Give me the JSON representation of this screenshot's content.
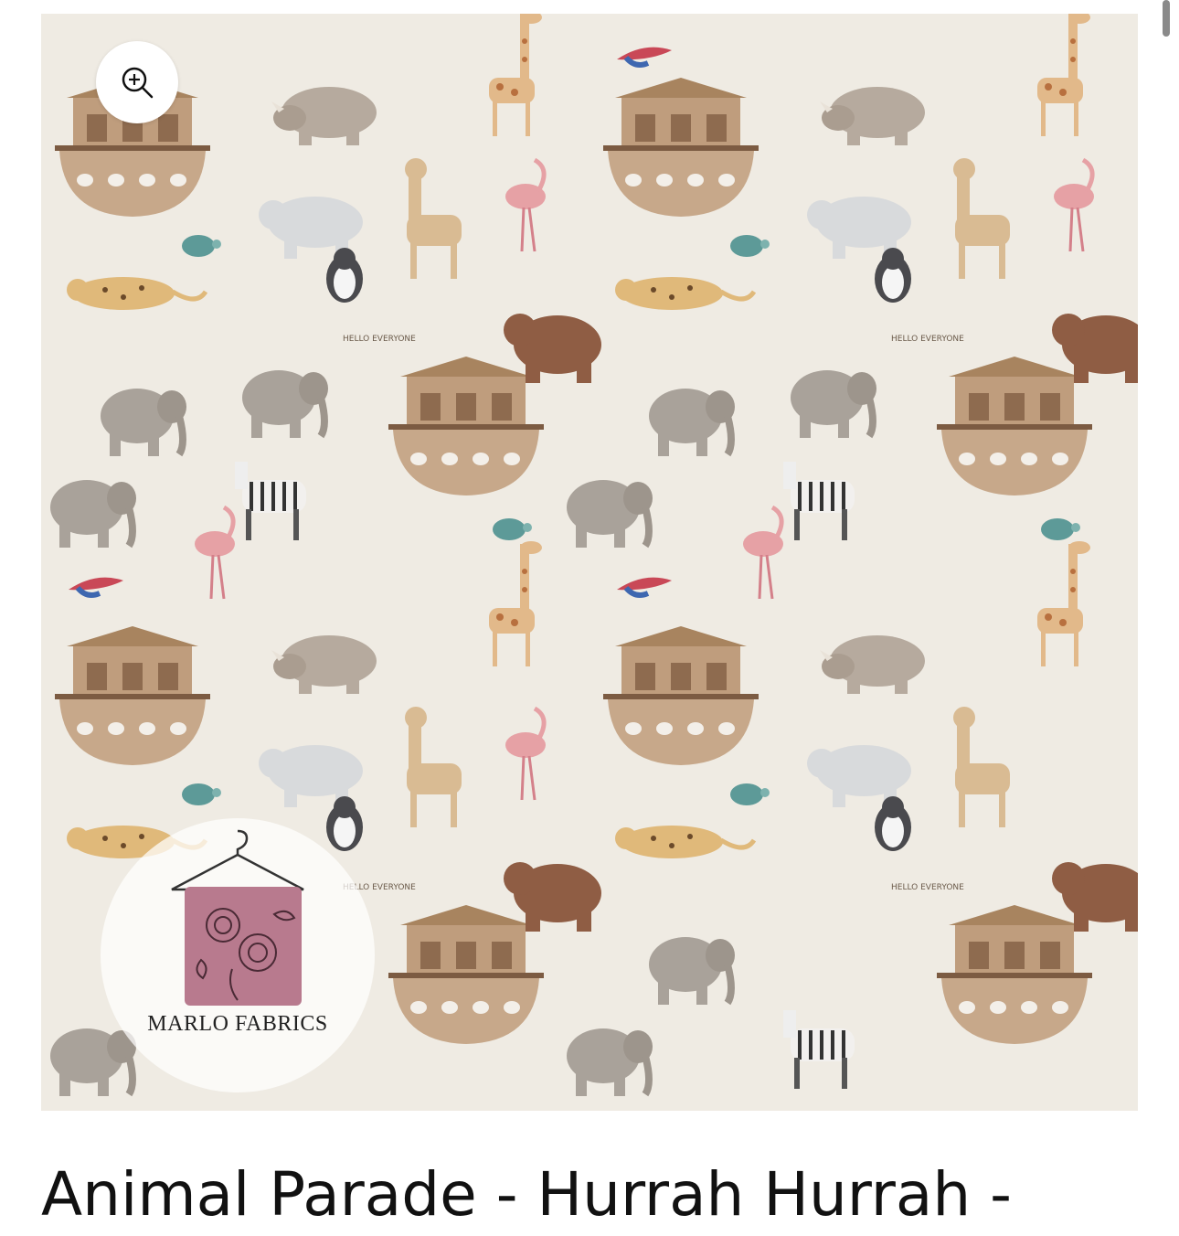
{
  "product": {
    "title": "Animal Parade - Hurrah Hurrah -",
    "image_alt": "Noah's ark animal parade fabric print",
    "pattern_banner_text": "HELLO EVERYONE"
  },
  "watermark": {
    "brand": "MARLO FABRICS"
  },
  "zoom": {
    "icon": "zoom-in-icon"
  },
  "colors": {
    "fabric_background": "#efebe3",
    "title_text": "#111111",
    "watermark_card": "#b87a8e"
  }
}
